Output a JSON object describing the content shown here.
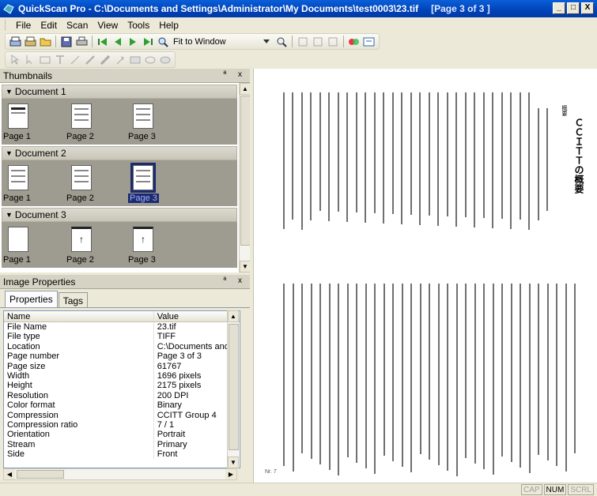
{
  "window": {
    "title": "QuickScan Pro - C:\\Documents and Settings\\Administrator\\My Documents\\test0003\\23.tif",
    "page_indicator": "[Page 3 of 3 ]",
    "min_label": "_",
    "max_label": "□",
    "close_label": "X"
  },
  "menu": [
    "File",
    "Edit",
    "Scan",
    "View",
    "Tools",
    "Help"
  ],
  "toolbar": {
    "fit_label": "Fit to Window"
  },
  "thumbnails": {
    "title": "Thumbnails",
    "panel_buttons": "ª x",
    "documents": [
      {
        "name": "Document 1",
        "pages": [
          "Page 1",
          "Page 2",
          "Page 3"
        ]
      },
      {
        "name": "Document 2",
        "pages": [
          "Page 1",
          "Page 2",
          "Page 3"
        ]
      },
      {
        "name": "Document 3",
        "pages": [
          "Page 1",
          "Page 2",
          "Page 3"
        ]
      }
    ],
    "selected": {
      "document": 2,
      "page": 3
    }
  },
  "properties": {
    "title": "Image Properties",
    "panel_buttons": "ª x",
    "tabs": [
      "Properties",
      "Tags"
    ],
    "columns": [
      "Name",
      "Value"
    ],
    "rows": [
      [
        "File Name",
        "23.tif"
      ],
      [
        "File type",
        "TIFF"
      ],
      [
        "Location",
        "C:\\Documents and S"
      ],
      [
        "Page number",
        "Page 3 of 3"
      ],
      [
        "Page size",
        "61767"
      ],
      [
        "Width",
        "1696 pixels"
      ],
      [
        "Height",
        "2175 pixels"
      ],
      [
        "Resolution",
        "200 DPI"
      ],
      [
        "Color format",
        "Binary"
      ],
      [
        "Compression",
        "CCITT Group 4"
      ],
      [
        "Compression ratio",
        "7 / 1"
      ],
      [
        "Orientation",
        "Portrait"
      ],
      [
        "Stream",
        "Primary"
      ],
      [
        "Side",
        "Front"
      ]
    ]
  },
  "document_view": {
    "heading": "ＣＣＩＴＴの概要",
    "kicker": "概要",
    "page_number": "Nr. 7"
  },
  "status": {
    "indicators": [
      "CAP",
      "NUM",
      "SCRL"
    ],
    "active": [
      "NUM"
    ]
  }
}
